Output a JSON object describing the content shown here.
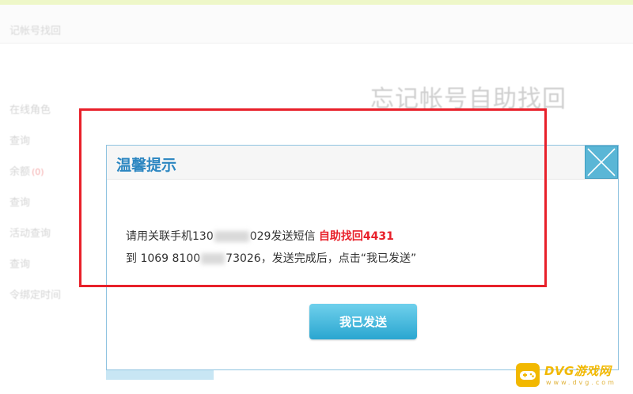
{
  "header": {
    "breadcrumb": "记帐号找回"
  },
  "main": {
    "page_title": "忘记帐号自助找回"
  },
  "sidebar": {
    "items": [
      {
        "label": "在线角色",
        "badge": ""
      },
      {
        "label": "查询",
        "badge": ""
      },
      {
        "label": "余额",
        "badge": "(0)"
      },
      {
        "label": "查询",
        "badge": ""
      },
      {
        "label": "活动查询",
        "badge": ""
      },
      {
        "label": "查询",
        "badge": ""
      },
      {
        "label": "令绑定时间",
        "badge": ""
      }
    ]
  },
  "dialog": {
    "title": "温馨提示",
    "line1_prefix": "请用关联手机130",
    "line1_suffix": "029发送短信",
    "sms_code": "自助找回4431",
    "line2_prefix": "到 1069 8100",
    "line2_suffix": "73026，发送完成后，点击“我已发送”",
    "sent_button": "我已发送",
    "close_icon": "close-x-icon"
  },
  "watermark": {
    "text": "DVG游戏网",
    "sub": "www.dvg.com"
  },
  "colors": {
    "accent": "#2b86c1",
    "button": "#2aa6d0",
    "highlight": "#e8202a",
    "annotation": "#e8202a",
    "watermark": "#f2b800"
  }
}
